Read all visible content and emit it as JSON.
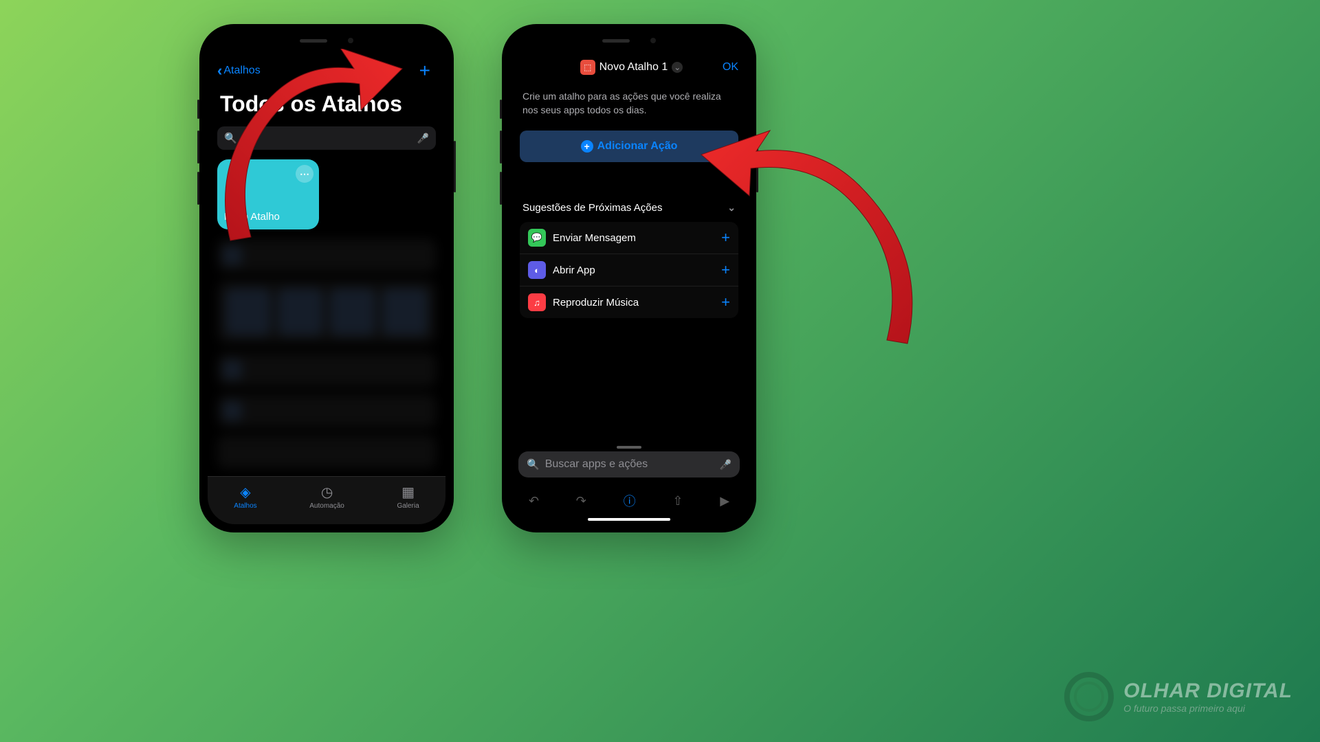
{
  "phone1": {
    "back_label": "Atalhos",
    "page_title": "Todos os Atalhos",
    "search_placeholder": "",
    "tile_label": "Novo Atalho",
    "tabs": {
      "shortcuts": "Atalhos",
      "automation": "Automação",
      "gallery": "Galeria"
    }
  },
  "phone2": {
    "title": "Novo Atalho 1",
    "ok": "OK",
    "description": "Crie um atalho para as ações que você realiza nos seus apps todos os dias.",
    "add_action": "Adicionar Ação",
    "suggestions_header": "Sugestões de Próximas Ações",
    "suggestions": [
      {
        "label": "Enviar Mensagem"
      },
      {
        "label": "Abrir App"
      },
      {
        "label": "Reproduzir Música"
      }
    ],
    "bottom_search": "Buscar apps e ações"
  },
  "brand": {
    "name": "OLHAR DIGITAL",
    "tagline": "O futuro passa primeiro aqui"
  }
}
